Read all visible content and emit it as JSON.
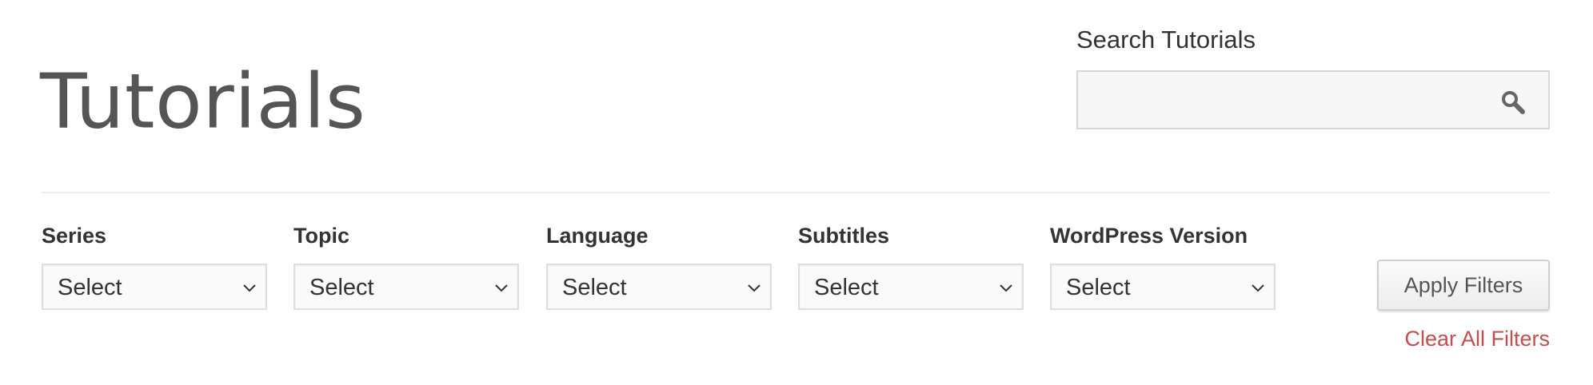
{
  "header": {
    "title": "Tutorials"
  },
  "search": {
    "label": "Search Tutorials",
    "value": "",
    "placeholder": "",
    "icon": "search-icon"
  },
  "filters": [
    {
      "label": "Series",
      "selected": "Select"
    },
    {
      "label": "Topic",
      "selected": "Select"
    },
    {
      "label": "Language",
      "selected": "Select"
    },
    {
      "label": "Subtitles",
      "selected": "Select"
    },
    {
      "label": "WordPress Version",
      "selected": "Select"
    }
  ],
  "actions": {
    "apply_label": "Apply Filters",
    "clear_label": "Clear All Filters"
  },
  "colors": {
    "title": "#555555",
    "text": "#333333",
    "link": "#c0504d",
    "border": "#d7d7d7"
  }
}
